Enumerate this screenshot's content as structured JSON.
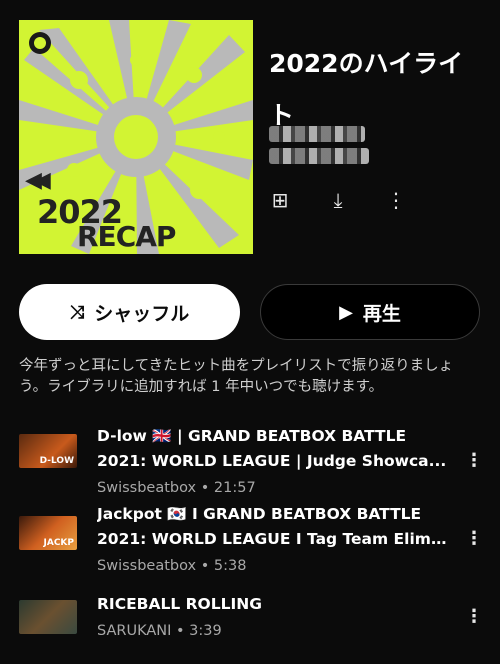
{
  "cover": {
    "year_text": "2022",
    "recap_text": "RECAP",
    "rewind_glyph": "◀◀",
    "badge_icon": "app-logo-icon",
    "accent": "#d2f433"
  },
  "playlist": {
    "title": "2022のハイライト",
    "actions": [
      {
        "name": "add-to-library-icon",
        "glyph": "⊞"
      },
      {
        "name": "download-icon",
        "glyph": "⤓"
      },
      {
        "name": "more-options-icon",
        "glyph": "⋮"
      }
    ]
  },
  "buttons": {
    "shuffle_label": "シャッフル",
    "shuffle_icon": "⤨",
    "play_label": "再生",
    "play_icon": "▶"
  },
  "description": "今年ずっと耳にしてきたヒット曲をプレイリストで振り返りましょう。ライブラリに追加すれば 1 年中いつでも聴けます。",
  "tracks": [
    {
      "line1": "D-low 🇬🇧 | GRAND BEATBOX BATTLE",
      "line2": "2021: WORLD LEAGUE | Judge Showca...",
      "artist": "Swissbeatbox",
      "duration": "21:57",
      "thumb_text": "D-LOW"
    },
    {
      "line1": "Jackpot 🇰🇷 I GRAND BEATBOX BATTLE",
      "line2": "2021: WORLD LEAGUE I Tag Team Elim...",
      "artist": "Swissbeatbox",
      "duration": "5:38",
      "thumb_text": "JACKP"
    },
    {
      "line1": "RICEBALL ROLLING",
      "line2": "",
      "artist": "SARUKANI",
      "duration": "3:39",
      "thumb_text": ""
    }
  ],
  "meta_sep": "•",
  "track_more_glyph": "⋮"
}
